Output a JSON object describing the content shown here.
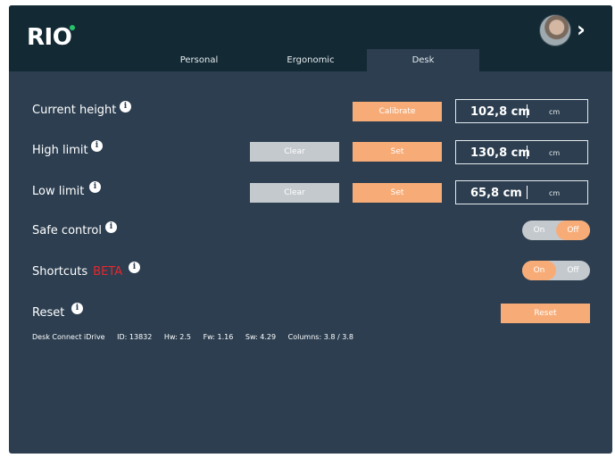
{
  "header": {
    "logo_text": "RIO",
    "tabs": [
      {
        "label": "Personal",
        "active": false
      },
      {
        "label": "Ergonomic",
        "active": false
      },
      {
        "label": "Desk",
        "active": true
      }
    ]
  },
  "rows": {
    "current_height": {
      "label": "Current height",
      "button": "Calibrate",
      "value": "102,8 cm",
      "unit": "cm"
    },
    "high_limit": {
      "label": "High limit",
      "clear": "Clear",
      "set": "Set",
      "value": "130,8 cm",
      "unit": "cm"
    },
    "low_limit": {
      "label": "Low limit",
      "clear": "Clear",
      "set": "Set",
      "value": "65,8 cm",
      "unit": "cm"
    },
    "safe_control": {
      "label": "Safe control",
      "on": "On",
      "off": "Off",
      "selected": "Off"
    },
    "shortcuts": {
      "label": "Shortcuts",
      "badge": "BETA",
      "on": "On",
      "off": "Off",
      "selected": "On"
    },
    "reset": {
      "label": "Reset",
      "button": "Reset"
    }
  },
  "footer": {
    "device": "Desk Connect iDrive",
    "id": "ID: 13832",
    "hw": "Hw: 2.5",
    "fw": "Fw: 1.16",
    "sw": "Sw: 4.29",
    "columns": "Columns: 3.8 / 3.8"
  },
  "icons": {
    "info": "i",
    "chevron": "›"
  },
  "colors": {
    "accent": "#f7ac77",
    "panel": "#2c3e50",
    "topbar": "#132a35",
    "beta": "#e8262d",
    "logo_dot": "#27c36b"
  }
}
